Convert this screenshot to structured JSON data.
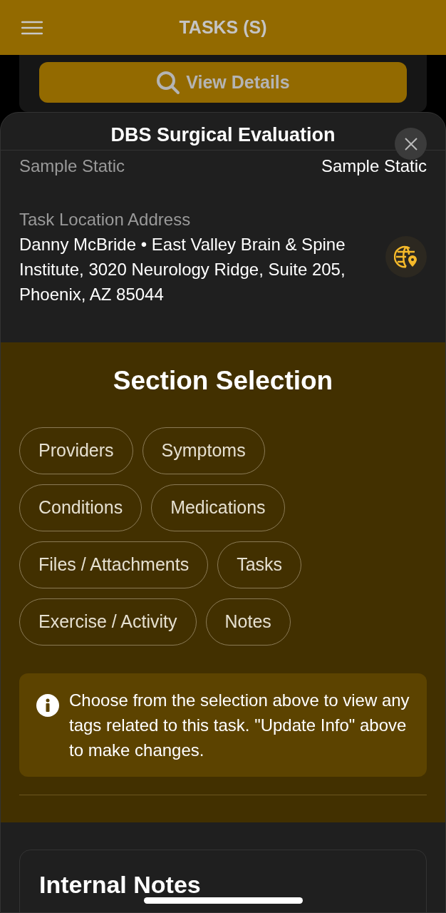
{
  "header": {
    "title": "TASKS (S)"
  },
  "view_details_button": {
    "label": "View Details"
  },
  "sheet": {
    "title": "DBS Surgical Evaluation",
    "fields": [
      {
        "label": "Sample Static",
        "value": "Sample Static"
      }
    ],
    "location": {
      "label": "Task Location Address",
      "address": "Danny McBride • East Valley Brain & Spine Institute, 3020 Neurology Ridge, Suite 205, Phoenix, AZ 85044"
    },
    "section_selection": {
      "title": "Section Selection",
      "chips": [
        "Providers",
        "Symptoms",
        "Conditions",
        "Medications",
        "Files / Attachments",
        "Tasks",
        "Exercise / Activity",
        "Notes"
      ],
      "info": "Choose from the selection above to view any tags related to this task. \"Update Info\" above to make changes."
    },
    "internal_notes": {
      "title": "Internal Notes"
    }
  }
}
